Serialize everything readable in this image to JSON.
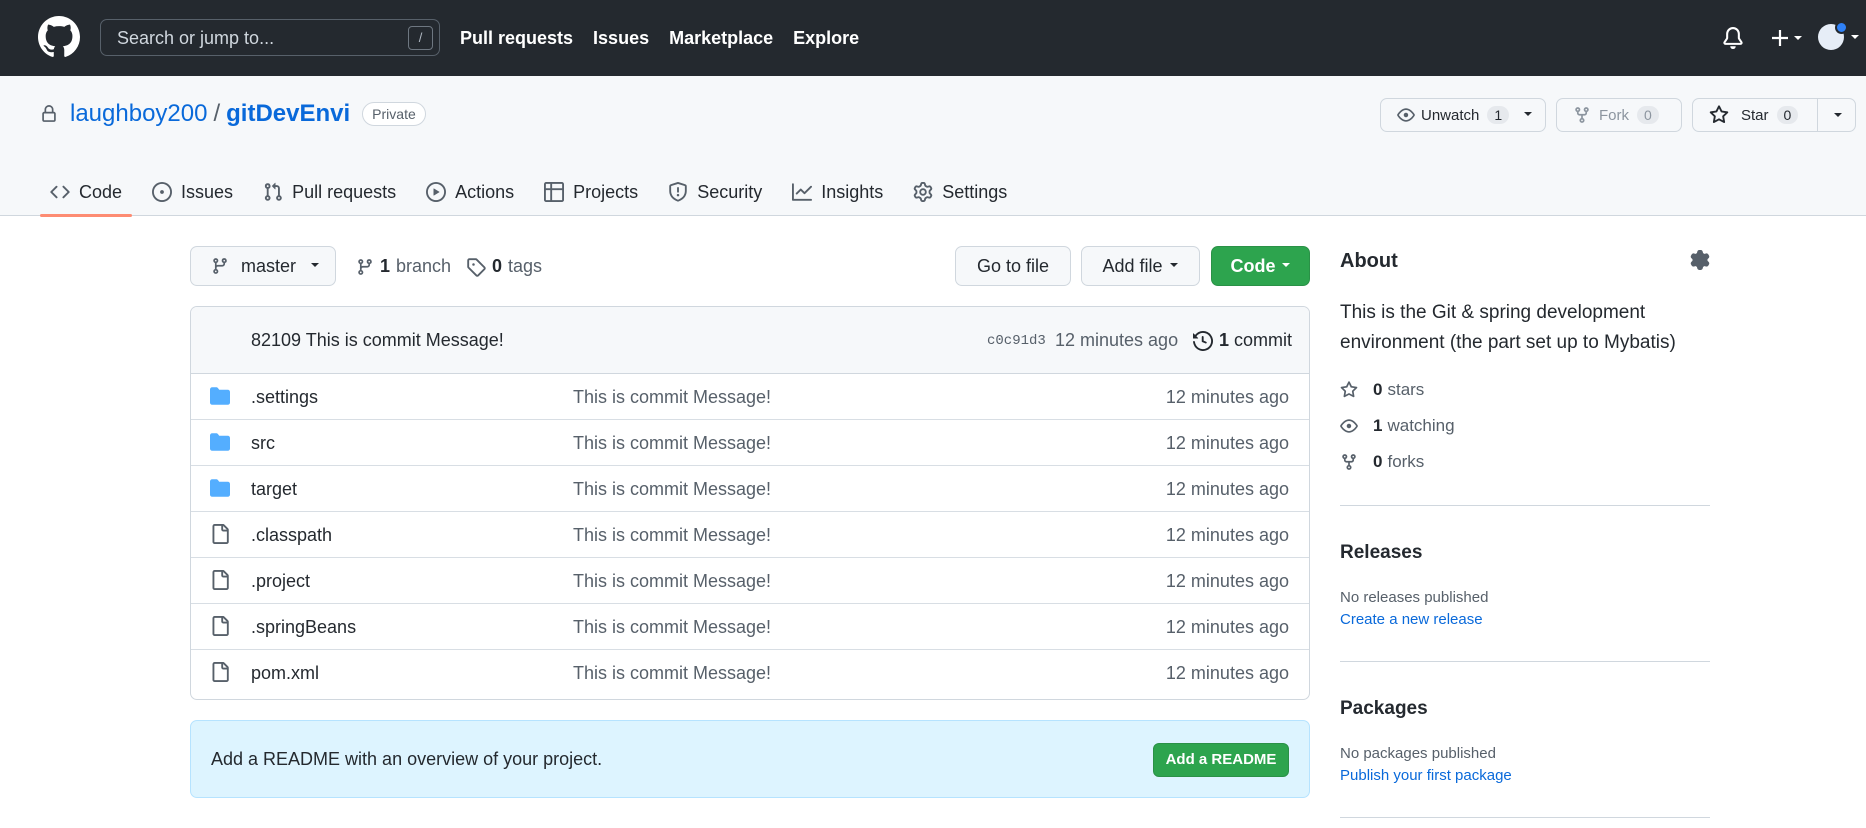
{
  "nav": {
    "search_placeholder": "Search or jump to...",
    "search_shortcut": "/",
    "links": [
      "Pull requests",
      "Issues",
      "Marketplace",
      "Explore"
    ]
  },
  "repo": {
    "owner": "laughboy200",
    "separator": "/",
    "name": "gitDevEnvi",
    "visibility": "Private",
    "unwatch_label": "Unwatch",
    "watch_count": "1",
    "fork_label": "Fork",
    "fork_count": "0",
    "star_label": "Star",
    "star_count": "0"
  },
  "tabs": [
    {
      "label": "Code",
      "icon": "code-icon"
    },
    {
      "label": "Issues",
      "icon": "issue-icon"
    },
    {
      "label": "Pull requests",
      "icon": "pull-request-icon"
    },
    {
      "label": "Actions",
      "icon": "play-icon"
    },
    {
      "label": "Projects",
      "icon": "table-icon"
    },
    {
      "label": "Security",
      "icon": "shield-icon"
    },
    {
      "label": "Insights",
      "icon": "graph-icon"
    },
    {
      "label": "Settings",
      "icon": "gear-icon"
    }
  ],
  "toolbar": {
    "branch": "master",
    "branch_count": "1",
    "branch_word": "branch",
    "tag_count": "0",
    "tag_word": "tags",
    "go_to_file": "Go to file",
    "add_file": "Add file",
    "code": "Code"
  },
  "commit": {
    "user": "82109",
    "message": "This is commit Message!",
    "sha": "c0c91d3",
    "time": "12 minutes ago",
    "count": "1",
    "count_word": "commit"
  },
  "files": [
    {
      "name": ".settings",
      "type": "folder",
      "message": "This is commit Message!",
      "time": "12 minutes ago"
    },
    {
      "name": "src",
      "type": "folder",
      "message": "This is commit Message!",
      "time": "12 minutes ago"
    },
    {
      "name": "target",
      "type": "folder",
      "message": "This is commit Message!",
      "time": "12 minutes ago"
    },
    {
      "name": ".classpath",
      "type": "file",
      "message": "This is commit Message!",
      "time": "12 minutes ago"
    },
    {
      "name": ".project",
      "type": "file",
      "message": "This is commit Message!",
      "time": "12 minutes ago"
    },
    {
      "name": ".springBeans",
      "type": "file",
      "message": "This is commit Message!",
      "time": "12 minutes ago"
    },
    {
      "name": "pom.xml",
      "type": "file",
      "message": "This is commit Message!",
      "time": "12 minutes ago"
    }
  ],
  "readme": {
    "text": "Add a README with an overview of your project.",
    "button": "Add a README"
  },
  "about": {
    "heading": "About",
    "description": "This is the Git & spring development environment (the part set up to Mybatis)",
    "stars_count": "0",
    "stars_word": "stars",
    "watching_count": "1",
    "watching_word": "watching",
    "forks_count": "0",
    "forks_word": "forks"
  },
  "releases": {
    "heading": "Releases",
    "note": "No releases published",
    "link": "Create a new release"
  },
  "packages": {
    "heading": "Packages",
    "note": "No packages published",
    "link": "Publish your first package"
  },
  "colors": {
    "nav_bg": "#24292f",
    "link": "#0969da",
    "green": "#2da44e",
    "folder": "#54aeff",
    "tab_underline": "#fd8c73"
  }
}
